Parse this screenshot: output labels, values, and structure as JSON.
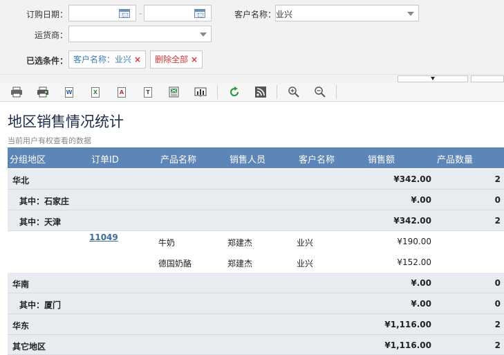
{
  "filters": {
    "order_date_label": "订购日期：",
    "date_separator": "-",
    "customer_label": "客户名称：",
    "customer_value": "业兴",
    "shipper_label": "运货商：",
    "selected_label": "已选条件：",
    "chip_customer": "客户名称：业兴",
    "chip_clear": "删除全部",
    "chip_x": "×"
  },
  "toolbar": {
    "icons": [
      "print-icon",
      "print-preview-icon",
      "export-word-icon",
      "export-excel-icon",
      "export-pdf-icon",
      "export-text-icon",
      "export-image-excel-icon",
      "chart-icon",
      "refresh-icon",
      "rss-icon",
      "zoom-in-icon",
      "zoom-out-icon"
    ],
    "word_letter": "W",
    "excel_letter": "X",
    "pdf_letter": "A",
    "text_letter": "T"
  },
  "report": {
    "title": "地区销售情况统计",
    "subtitle": "当前用户有权查看的数据",
    "columns": [
      "分组地区",
      "订单ID",
      "产品名称",
      "销售人员",
      "客户名称",
      "销售额",
      "产品数量"
    ],
    "rows": [
      {
        "type": "group",
        "region": "华北",
        "amount": "¥342.00",
        "qty": "2"
      },
      {
        "type": "group",
        "region": "其中：石家庄",
        "amount": "¥.00",
        "qty": "0"
      },
      {
        "type": "group",
        "region": "其中：天津",
        "amount": "¥342.00",
        "qty": "2"
      },
      {
        "type": "detail",
        "order_id": "11049",
        "product": "牛奶",
        "sales": "郑建杰",
        "customer": "业兴",
        "amount": "¥190.00"
      },
      {
        "type": "detail",
        "order_id": "",
        "product": "德国奶酪",
        "sales": "郑建杰",
        "customer": "业兴",
        "amount": "¥152.00"
      },
      {
        "type": "group",
        "region": "华南",
        "amount": "¥.00",
        "qty": "0"
      },
      {
        "type": "group",
        "region": "其中：厦门",
        "amount": "¥.00",
        "qty": "0"
      },
      {
        "type": "group",
        "region": "华东",
        "amount": "¥1,116.00",
        "qty": "2"
      },
      {
        "type": "group",
        "region": "其它地区",
        "amount": "¥1,116.00",
        "qty": "2"
      }
    ]
  },
  "colors": {
    "header_bg": "#5c86b7",
    "group_row_bg": "#e8ecf1",
    "link": "#3a6aa8",
    "chip_red": "#d33",
    "chip_blue": "#3a7fc1"
  }
}
